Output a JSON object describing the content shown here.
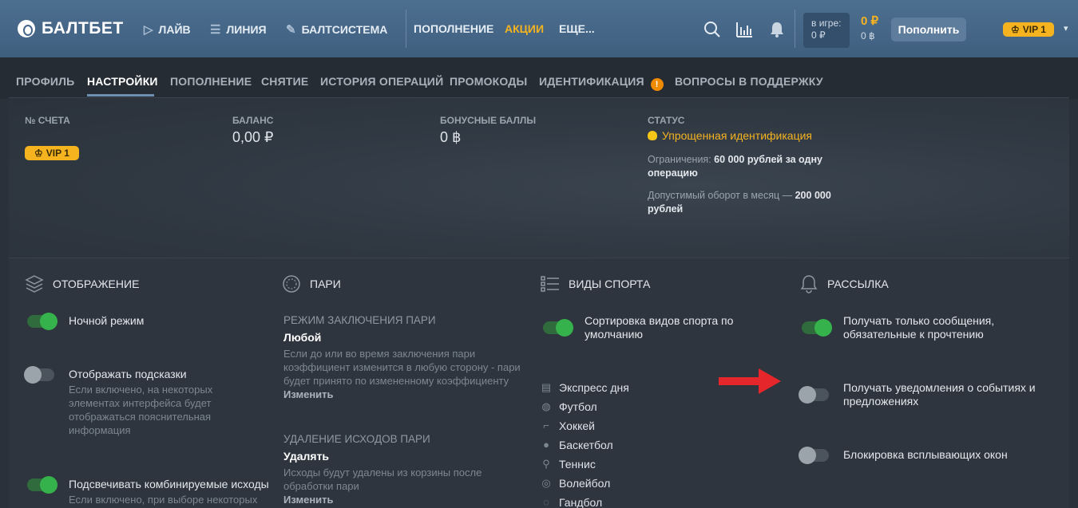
{
  "header": {
    "logo": "БАЛТБЕТ",
    "nav": [
      {
        "label": "ЛАЙВ",
        "icon": "play-circle-icon"
      },
      {
        "label": "ЛИНИЯ",
        "icon": "list-icon"
      },
      {
        "label": "БАЛТСИСТЕМА",
        "icon": "rocket-icon"
      },
      {
        "label": "ПОПОЛНЕНИЕ"
      },
      {
        "label": "АКЦИИ"
      },
      {
        "label": "ЕЩЕ..."
      }
    ],
    "accent_color": "#f5b320",
    "in_game_label": "в игре:",
    "in_game_value": "0 ₽",
    "balance_rub": "0 ₽",
    "balance_bonus": "0 ฿",
    "deposit_button": "Пополнить",
    "vip": "VIP 1"
  },
  "tabs": [
    {
      "label": "ПРОФИЛЬ"
    },
    {
      "label": "НАСТРОЙКИ",
      "active": true
    },
    {
      "label": "ПОПОЛНЕНИЕ"
    },
    {
      "label": "СНЯТИЕ"
    },
    {
      "label": "ИСТОРИЯ ОПЕРАЦИЙ"
    },
    {
      "label": "ПРОМОКОДЫ"
    },
    {
      "label": "ИДЕНТИФИКАЦИЯ",
      "warning": "!"
    },
    {
      "label": "ВОПРОСЫ В ПОДДЕРЖКУ"
    }
  ],
  "account": {
    "number_label": "№ СЧЕТА",
    "vip": "VIP 1",
    "balance_label": "БАЛАНС",
    "balance_value": "0,00 ₽",
    "bonus_label": "БОНУСНЫЕ БАЛЛЫ",
    "bonus_value": "0 ฿",
    "status_label": "СТАТУС",
    "status_value": "Упрощенная идентификация",
    "limit_prefix": "Ограничения: ",
    "limit_value": "60 000 рублей за одну операцию",
    "turnover_prefix": "Допустимый оборот в месяц — ",
    "turnover_value": "200 000 рублей"
  },
  "display": {
    "title": "ОТОБРАЖЕНИЕ",
    "night_mode": {
      "label": "Ночной режим",
      "on": true
    },
    "hints": {
      "label": "Отображать подсказки",
      "on": false,
      "description": "Если включено, на некоторых элементах интерфейса будет отображаться пояснительная информация"
    },
    "highlight": {
      "label": "Подсвечивать комбинируемые исходы",
      "on": true,
      "description": "Если включено, при выборе некоторых"
    }
  },
  "bets": {
    "title": "ПАРИ",
    "mode_label": "РЕЖИМ ЗАКЛЮЧЕНИЯ ПАРИ",
    "mode_value": "Любой",
    "mode_desc": "Если до или во время заключения пари коэффициент изменится в любую сторону - пари будет принято по измененному коэффициенту",
    "change": "Изменить",
    "removal_label": "УДАЛЕНИЕ ИСХОДОВ ПАРИ",
    "removal_value": "Удалять",
    "removal_desc": "Исходы будут удалены из корзины после обработки пари",
    "change2": "Изменить"
  },
  "sports": {
    "title": "ВИДЫ СПОРТА",
    "sort_default": {
      "label": "Сортировка видов спорта по умолчанию",
      "on": true
    },
    "items": [
      "Экспресс дня",
      "Футбол",
      "Хоккей",
      "Баскетбол",
      "Теннис",
      "Волейбол",
      "Гандбол"
    ]
  },
  "mailing": {
    "title": "РАССЫЛКА",
    "required_only": {
      "label": "Получать только сообщения, обязательные к прочтению",
      "on": true
    },
    "events": {
      "label": "Получать уведомления о событиях и предложениях",
      "on": false
    },
    "popups": {
      "label": "Блокировка всплывающих окон",
      "on": false
    }
  }
}
